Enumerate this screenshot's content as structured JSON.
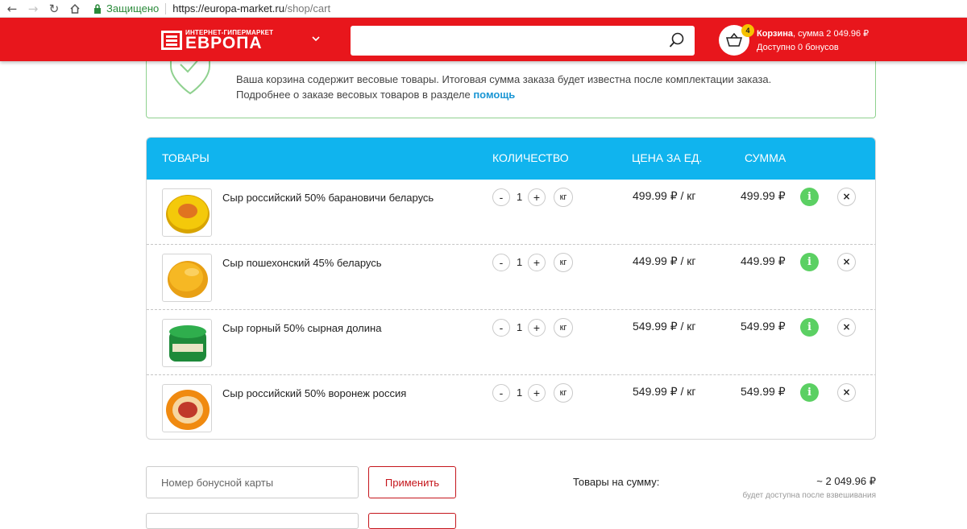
{
  "browser": {
    "secure_label": "Защищено",
    "url_host": "https://europa-market.ru",
    "url_path": "/shop/cart"
  },
  "header": {
    "logo_small": "ИНТЕРНЕТ-ГИПЕРМАРКЕТ",
    "logo_big": "ЕВРОПА",
    "search_placeholder": "",
    "cart_count": "4",
    "cart_title": "Корзина",
    "cart_sum": ", сумма 2 049.96 ₽",
    "bonus_text": "Доступно 0 бонусов",
    "brand_color": "#e8161c"
  },
  "notice": {
    "line1": "Ваша корзина содержит весовые товары. Итоговая сумма заказа будет известна после комплектации заказа.",
    "line2": "Подробнее о заказе весовых товаров в разделе ",
    "link": "помощь"
  },
  "table": {
    "headers": {
      "goods": "ТОВАРЫ",
      "qty": "КОЛИЧЕСТВО",
      "unit_price": "ЦЕНА ЗА ЕД.",
      "sum": "СУММА"
    },
    "minus": "-",
    "plus": "+",
    "info": "i",
    "remove": "×",
    "items": [
      {
        "name": "Сыр российский 50% барановичи беларусь",
        "qty": "1",
        "unit": "кг",
        "unit_price": "499.99 ₽ / кг",
        "sum": "499.99 ₽"
      },
      {
        "name": "Сыр пошехонский 45% беларусь",
        "qty": "1",
        "unit": "кг",
        "unit_price": "449.99 ₽ / кг",
        "sum": "449.99 ₽"
      },
      {
        "name": "Сыр горный 50% сырная долина",
        "qty": "1",
        "unit": "кг",
        "unit_price": "549.99 ₽ / кг",
        "sum": "549.99 ₽"
      },
      {
        "name": "Сыр российский 50% воронеж россия",
        "qty": "1",
        "unit": "кг",
        "unit_price": "549.99 ₽ / кг",
        "sum": "549.99 ₽"
      }
    ]
  },
  "summary": {
    "bonus_placeholder": "Номер бонусной карты",
    "apply_label": "Применить",
    "total_label": "Товары на сумму:",
    "total_value": "~ 2 049.96 ₽",
    "total_note": "будет доступна после взвешивания"
  }
}
